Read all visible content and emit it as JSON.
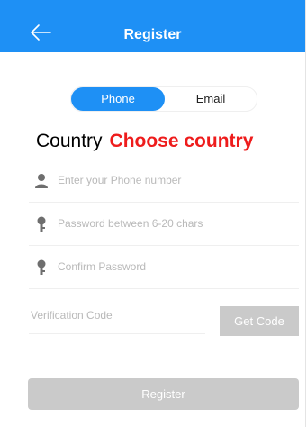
{
  "header": {
    "title": "Register",
    "back_icon": "arrow-left-icon",
    "background": "#1e90f5"
  },
  "tabs": {
    "phone_label": "Phone",
    "email_label": "Email",
    "selected": "Phone"
  },
  "country": {
    "label": "Country",
    "value": "Choose country",
    "value_color": "#ee1c1c"
  },
  "fields": {
    "phone": {
      "placeholder": "Enter your Phone number",
      "icon": "person-icon"
    },
    "password": {
      "placeholder": "Password between 6-20 chars",
      "icon": "key-icon"
    },
    "confirm": {
      "placeholder": "Confirm Password",
      "icon": "key-icon"
    }
  },
  "verification": {
    "placeholder": "Verification Code",
    "button_label": "Get Code"
  },
  "register_button": {
    "label": "Register"
  }
}
